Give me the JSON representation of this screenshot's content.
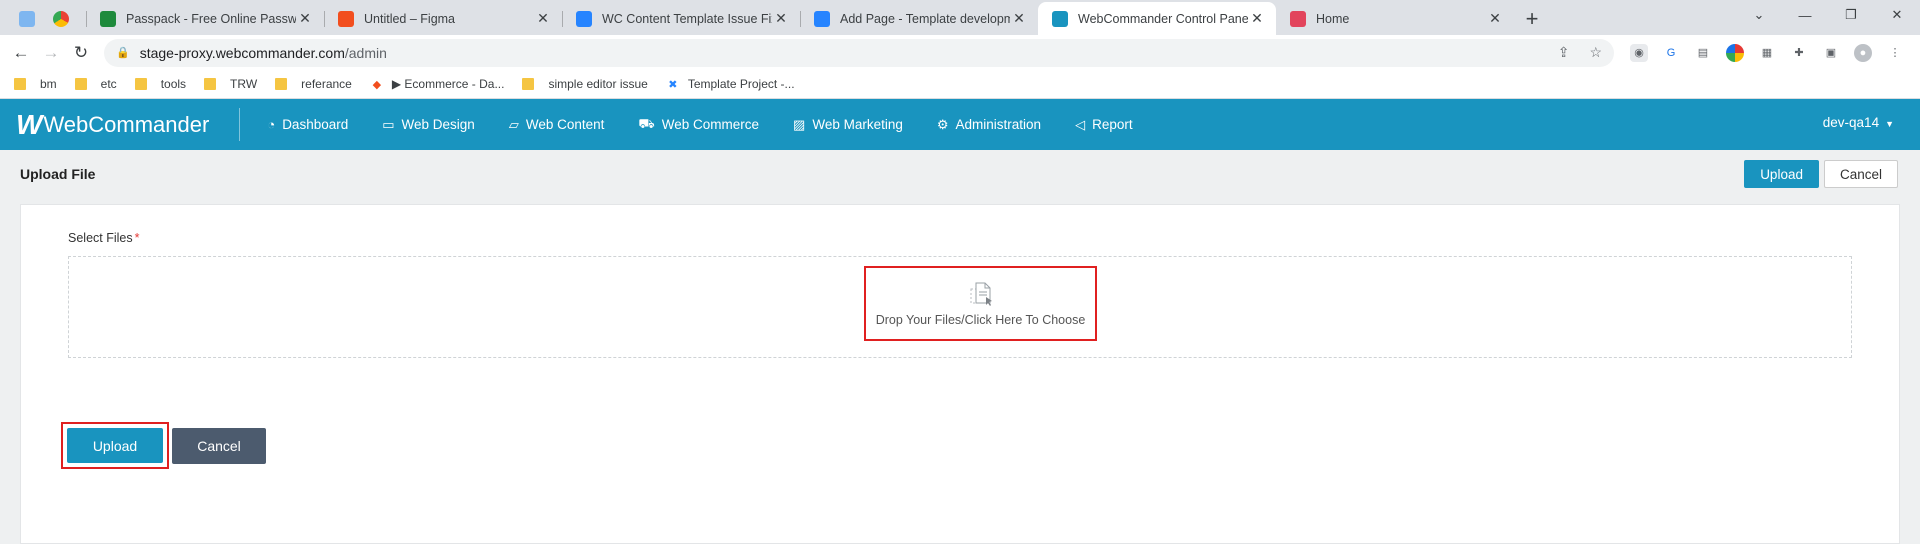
{
  "browser": {
    "tabs": [
      {
        "title": "Passpack - Free Online Password",
        "fav_color": "#1e8a3c",
        "fav_icon": "passpack-icon"
      },
      {
        "title": "Untitled – Figma",
        "fav_color": "#f24e1e",
        "fav_icon": "figma-icon"
      },
      {
        "title": "WC Content Template Issue Fixin",
        "fav_color": "#2684ff",
        "fav_icon": "confluence-icon"
      },
      {
        "title": "Add Page - Template developme",
        "fav_color": "#2684ff",
        "fav_icon": "confluence-icon"
      },
      {
        "title": "WebCommander Control Panel",
        "fav_color": "#1994bf",
        "fav_icon": "webcommander-icon"
      },
      {
        "title": "Home",
        "fav_color": "#e2445c",
        "fav_icon": "monday-icon"
      }
    ],
    "active_tab": 4,
    "url_host": "stage-proxy.webcommander.com",
    "url_path": "/admin",
    "bookmarks": [
      {
        "label": "bm",
        "type": "folder"
      },
      {
        "label": "etc",
        "type": "folder"
      },
      {
        "label": "tools",
        "type": "folder"
      },
      {
        "label": "TRW",
        "type": "folder"
      },
      {
        "label": "referance",
        "type": "folder"
      },
      {
        "label": "▶ Ecommerce - Da...",
        "type": "figma"
      },
      {
        "label": "simple editor issue",
        "type": "folder"
      },
      {
        "label": "Template Project -...",
        "type": "confluence"
      }
    ]
  },
  "app": {
    "brand": "WebCommander",
    "menu": [
      {
        "label": "Dashboard",
        "icon": "dashboard-icon"
      },
      {
        "label": "Web Design",
        "icon": "monitor-icon"
      },
      {
        "label": "Web Content",
        "icon": "folder-icon"
      },
      {
        "label": "Web Commerce",
        "icon": "cart-icon"
      },
      {
        "label": "Web Marketing",
        "icon": "chart-icon"
      },
      {
        "label": "Administration",
        "icon": "gear-icon"
      },
      {
        "label": "Report",
        "icon": "megaphone-icon"
      }
    ],
    "user": "dev-qa14"
  },
  "page": {
    "title": "Upload File",
    "top_upload": "Upload",
    "top_cancel": "Cancel",
    "field_label": "Select Files",
    "required_mark": "*",
    "drop_text": "Drop Your Files/Click Here To Choose",
    "bottom_upload": "Upload",
    "bottom_cancel": "Cancel"
  },
  "colors": {
    "brand": "#1994bf",
    "highlight": "#e02020",
    "cancel_dark": "#4c5b6e"
  }
}
